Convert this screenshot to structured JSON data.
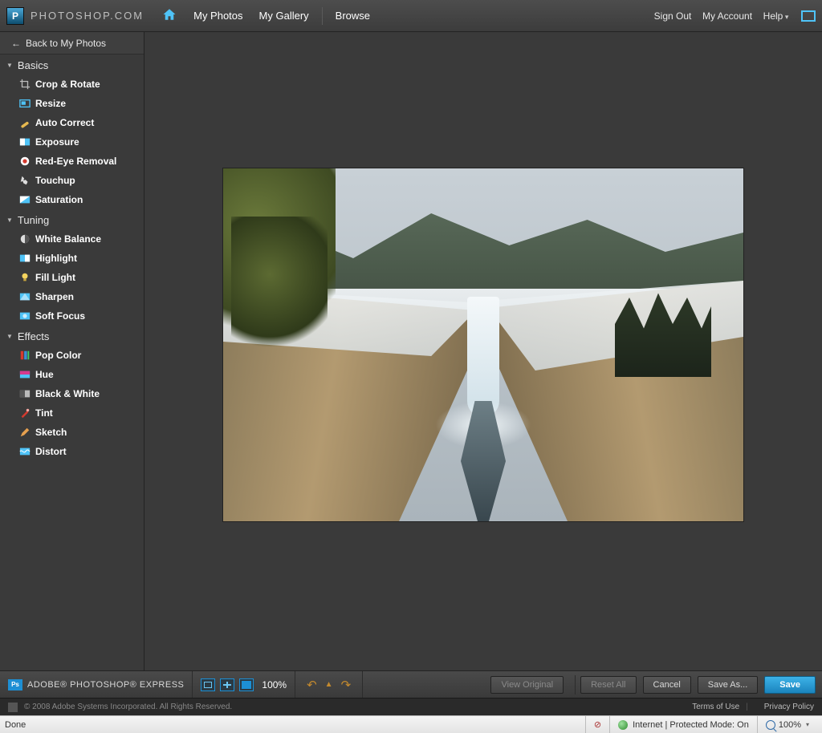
{
  "top": {
    "brand": "PHOTOSHOP.COM",
    "nav": {
      "my_photos": "My Photos",
      "my_gallery": "My Gallery",
      "browse": "Browse"
    },
    "right": {
      "sign_out": "Sign Out",
      "my_account": "My Account",
      "help": "Help"
    }
  },
  "sidebar": {
    "back": "Back to My Photos",
    "groups": [
      {
        "title": "Basics",
        "tools": [
          {
            "key": "crop",
            "label": "Crop & Rotate"
          },
          {
            "key": "resize",
            "label": "Resize"
          },
          {
            "key": "auto",
            "label": "Auto Correct"
          },
          {
            "key": "exposure",
            "label": "Exposure"
          },
          {
            "key": "redeye",
            "label": "Red-Eye Removal"
          },
          {
            "key": "touchup",
            "label": "Touchup"
          },
          {
            "key": "sat",
            "label": "Saturation"
          }
        ]
      },
      {
        "title": "Tuning",
        "tools": [
          {
            "key": "wb",
            "label": "White Balance"
          },
          {
            "key": "hl",
            "label": "Highlight"
          },
          {
            "key": "fill",
            "label": "Fill Light"
          },
          {
            "key": "sharpen",
            "label": "Sharpen"
          },
          {
            "key": "soft",
            "label": "Soft Focus"
          }
        ]
      },
      {
        "title": "Effects",
        "tools": [
          {
            "key": "pop",
            "label": "Pop Color"
          },
          {
            "key": "hue",
            "label": "Hue"
          },
          {
            "key": "bw",
            "label": "Black & White"
          },
          {
            "key": "tint",
            "label": "Tint"
          },
          {
            "key": "sketch",
            "label": "Sketch"
          },
          {
            "key": "distort",
            "label": "Distort"
          }
        ]
      }
    ]
  },
  "bottom": {
    "product": "ADOBE® PHOTOSHOP® EXPRESS",
    "zoom": "100%",
    "view_original": "View Original",
    "reset": "Reset All",
    "cancel": "Cancel",
    "save_as": "Save As...",
    "save": "Save"
  },
  "footer": {
    "copyright": "© 2008 Adobe Systems Incorporated. All Rights Reserved.",
    "terms": "Terms of Use",
    "privacy": "Privacy Policy"
  },
  "browser": {
    "status": "Done",
    "zone": "Internet | Protected Mode: On",
    "zoom": "100%"
  }
}
